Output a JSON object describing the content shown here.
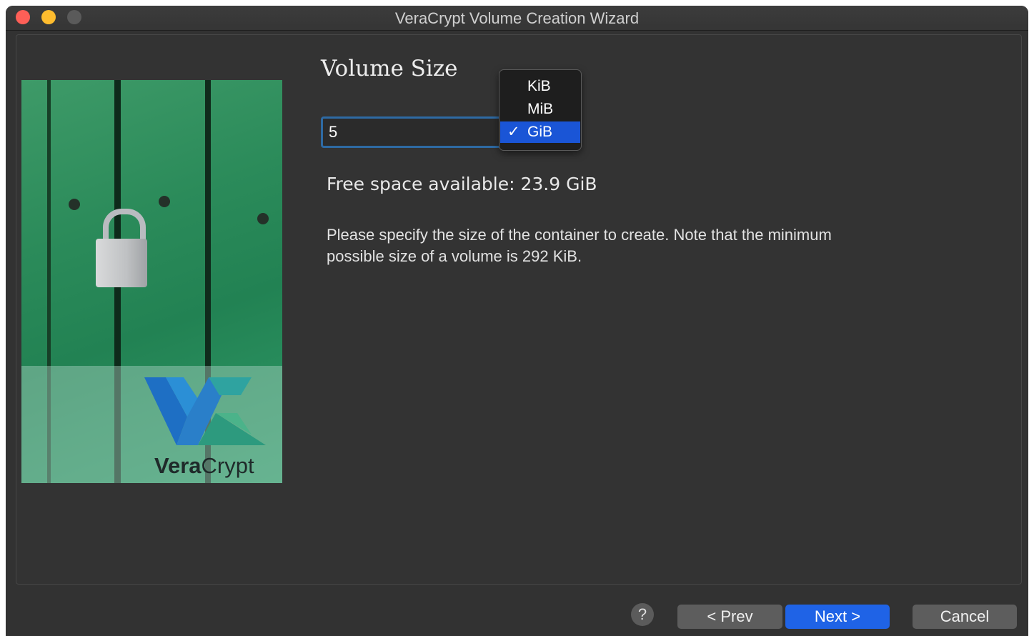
{
  "window": {
    "title": "VeraCrypt Volume Creation Wizard"
  },
  "page": {
    "heading": "Volume Size",
    "size_value": "5",
    "unit_options": [
      "KiB",
      "MiB",
      "GiB"
    ],
    "selected_unit": "GiB",
    "free_space": "Free space available: 23.9 GiB",
    "description": "Please specify the size of the container to create. Note that the minimum possible size of a volume is 292 KiB."
  },
  "logo": {
    "brand_bold": "Vera",
    "brand_rest": "Crypt"
  },
  "buttons": {
    "help": "?",
    "prev": "< Prev",
    "next": "Next >",
    "cancel": "Cancel"
  },
  "colors": {
    "accent": "#1f63e6",
    "selection": "#1a55d6"
  }
}
